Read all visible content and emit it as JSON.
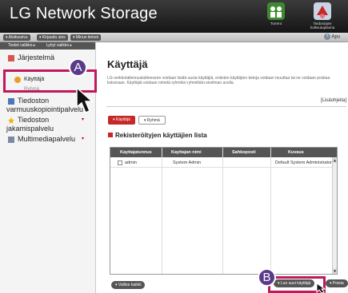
{
  "header": {
    "app_title": "LG Network Storage",
    "buttons": [
      {
        "label": "Torrent",
        "icon": "torrent-icon"
      },
      {
        "label": "Tiedostojen kulkeutuplanna",
        "icon": "transfer-icon"
      }
    ]
  },
  "subbar": {
    "links": [
      "▾ Aloitussivu",
      "▾ Kirjaudu ulos",
      "▾ Minun tietoni"
    ],
    "help": "Apu"
  },
  "sidebar": {
    "tabs": [
      "Tiedot valikko ▸",
      "Lyhyt valikko ▸"
    ],
    "items": [
      {
        "label": "Järjestelmä",
        "icon": "system-icon"
      },
      {
        "label": "Käyttäjä",
        "icon": "user-icon"
      },
      {
        "label": "Ryhmä",
        "icon": "group-icon"
      },
      {
        "label": "Tiedoston",
        "label2": "varmuuskopiointipalvelu",
        "icon": "backup-icon"
      },
      {
        "label": "Tiedoston",
        "label2": "jakamispalvelu",
        "icon": "share-icon"
      },
      {
        "label": "Multimediapalvelu",
        "icon": "multimedia-icon"
      }
    ]
  },
  "callouts": {
    "a": "A",
    "b": "B"
  },
  "main": {
    "title": "Käyttäjä",
    "description": "LG-verkkotallennuslaitteeseen voidaan lisätä uusia käyttäjiä, entisten käyttäjien tietoja voidaan muuttaa tai ne voidaan poistaa kokonaan. Käyttäjiä voidaan nimetä ryhmiksi ryhmittäin-sivelman avulla.",
    "more_link": "[Lisäohjeita]",
    "tabs": [
      "▾ Käyttäjä",
      "▾ Ryhmä"
    ],
    "list_title": "Rekisteröityjen käyttäjien lista",
    "table": {
      "columns": [
        "Kayttajatunnus",
        "Kayttajan nimi",
        "Sahkoposti",
        "Kuvaus"
      ],
      "rows": [
        {
          "username": "admin",
          "name": "System Admin",
          "email": "",
          "description": "Default System Administrator"
        }
      ]
    },
    "buttons": {
      "back": "▾ Valitse kaikki",
      "add": "▾ Luo uusi käyttäjä",
      "delete": "▾ Poista"
    }
  },
  "colors": {
    "accent": "#c62828",
    "highlight": "#c2185b",
    "callout": "#5a3a8a"
  }
}
